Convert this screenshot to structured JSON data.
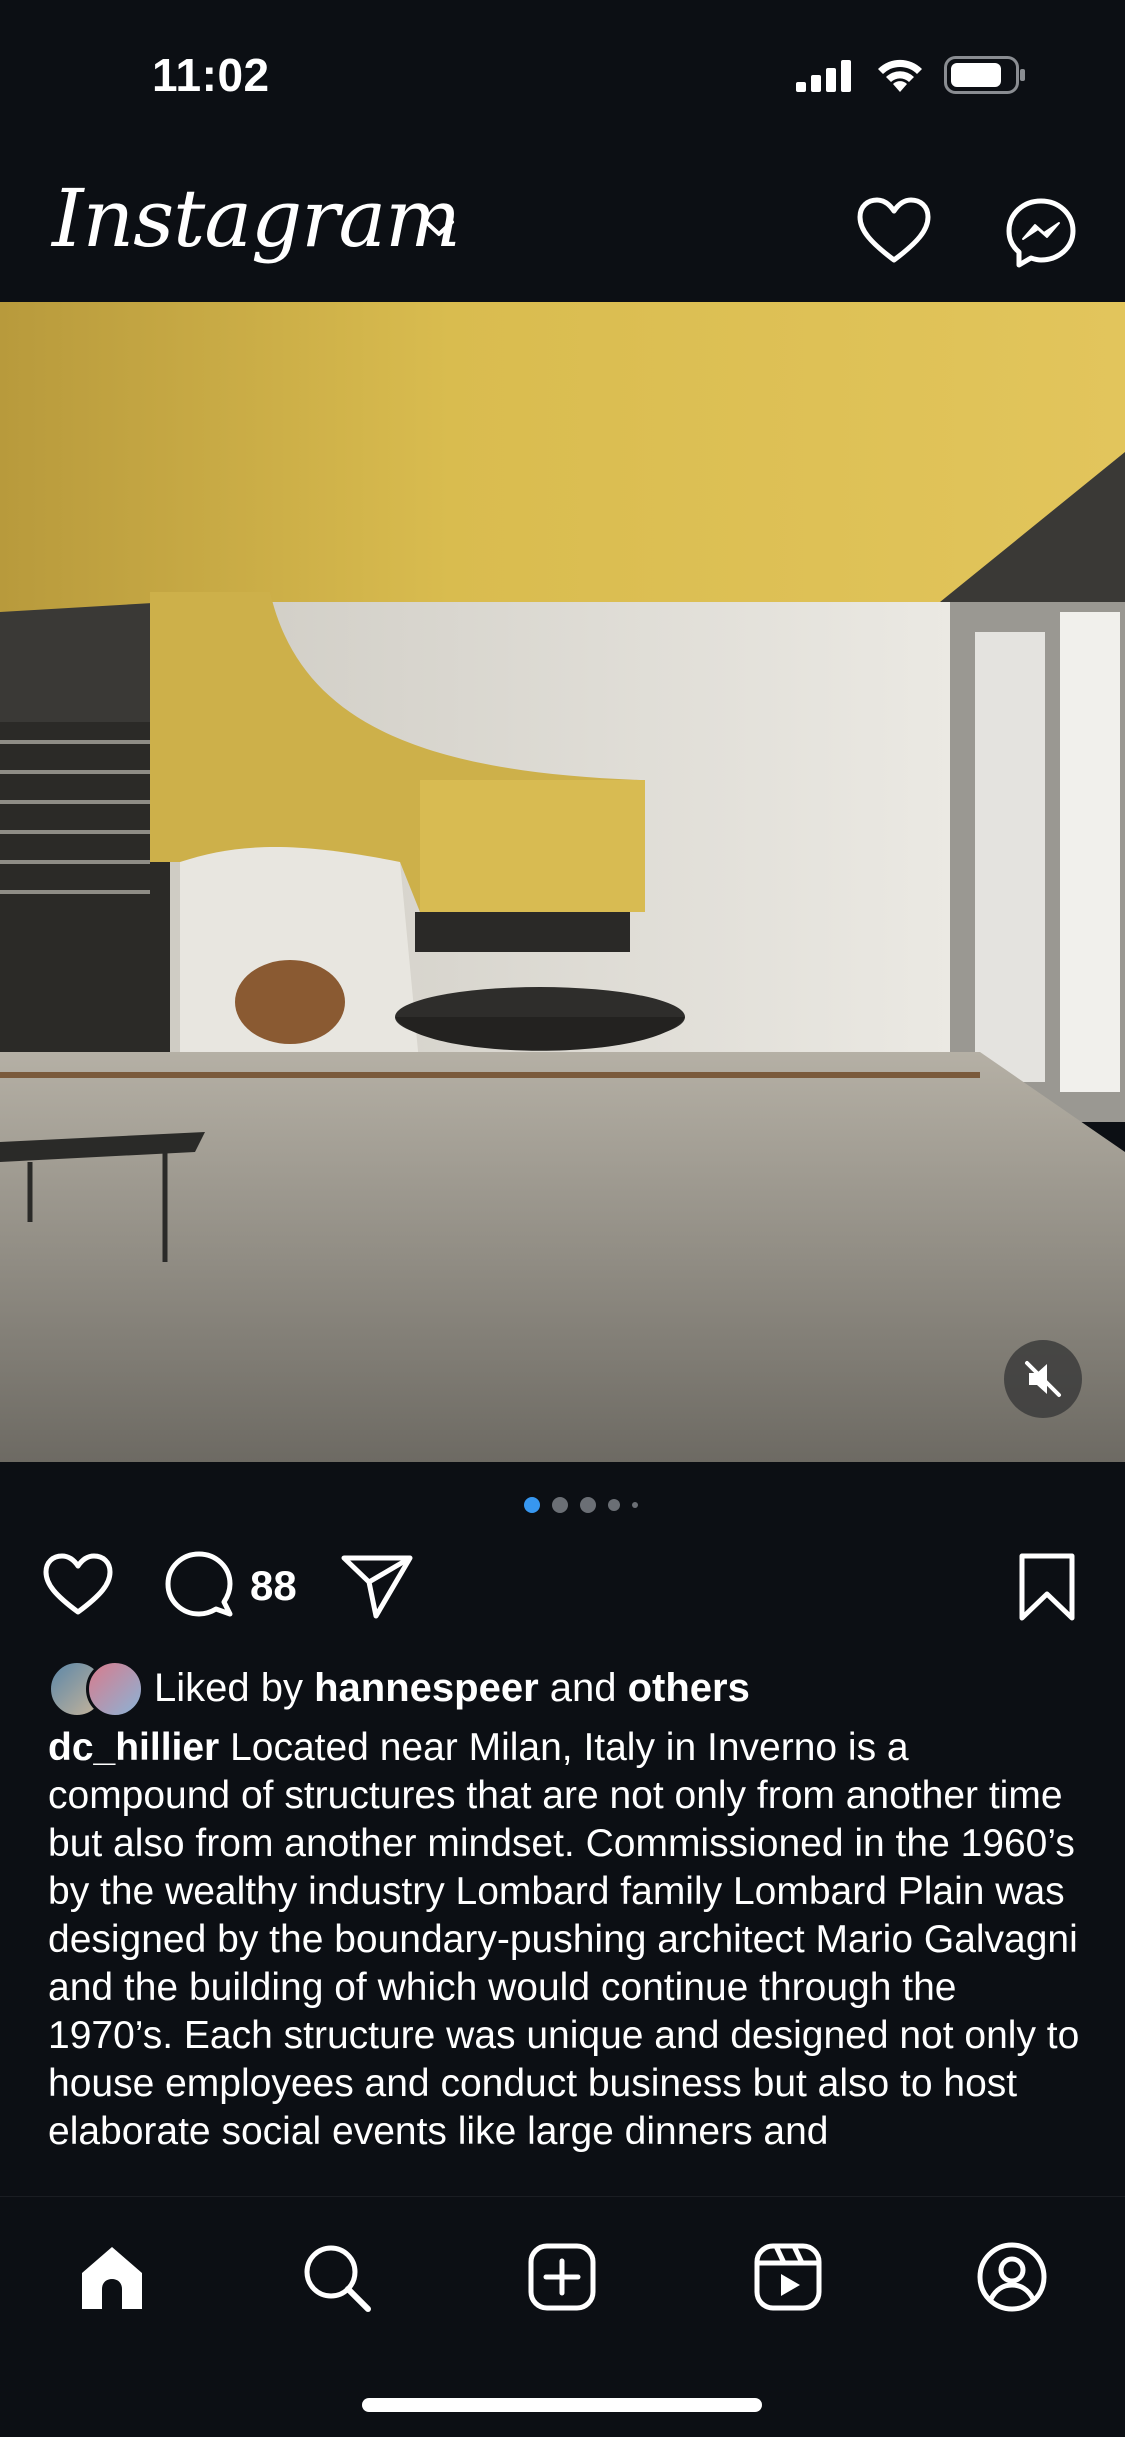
{
  "status_bar": {
    "time": "11:02"
  },
  "header": {
    "logo": "Instagram"
  },
  "post": {
    "comment_count": "88",
    "carousel": {
      "total": 5,
      "active_index": 0
    },
    "likes": {
      "prefix": "Liked by ",
      "user": "hannespeer",
      "joiner": " and ",
      "others": "others"
    },
    "caption": {
      "username": "dc_hillier",
      "text": " Located near Milan, Italy in Inverno is a compound of structures that are not only from another time but also from another mindset. Commissioned in the 1960’s by the wealthy industry Lombard family Lombard Plain was designed by the boundary-pushing architect Mario Galvagni and the building of which would continue through the 1970’s. Each structure was unique and designed not only to house employees and conduct business but also to host elaborate social events like large dinners and"
    }
  },
  "tabs": [
    {
      "icon": "home-icon"
    },
    {
      "icon": "search-icon"
    },
    {
      "icon": "create-icon"
    },
    {
      "icon": "reels-icon"
    },
    {
      "icon": "profile-icon"
    }
  ],
  "colors": {
    "background": "#0c0f14",
    "active_dot": "#3797f0",
    "inactive_dot": "#6b6f75"
  }
}
